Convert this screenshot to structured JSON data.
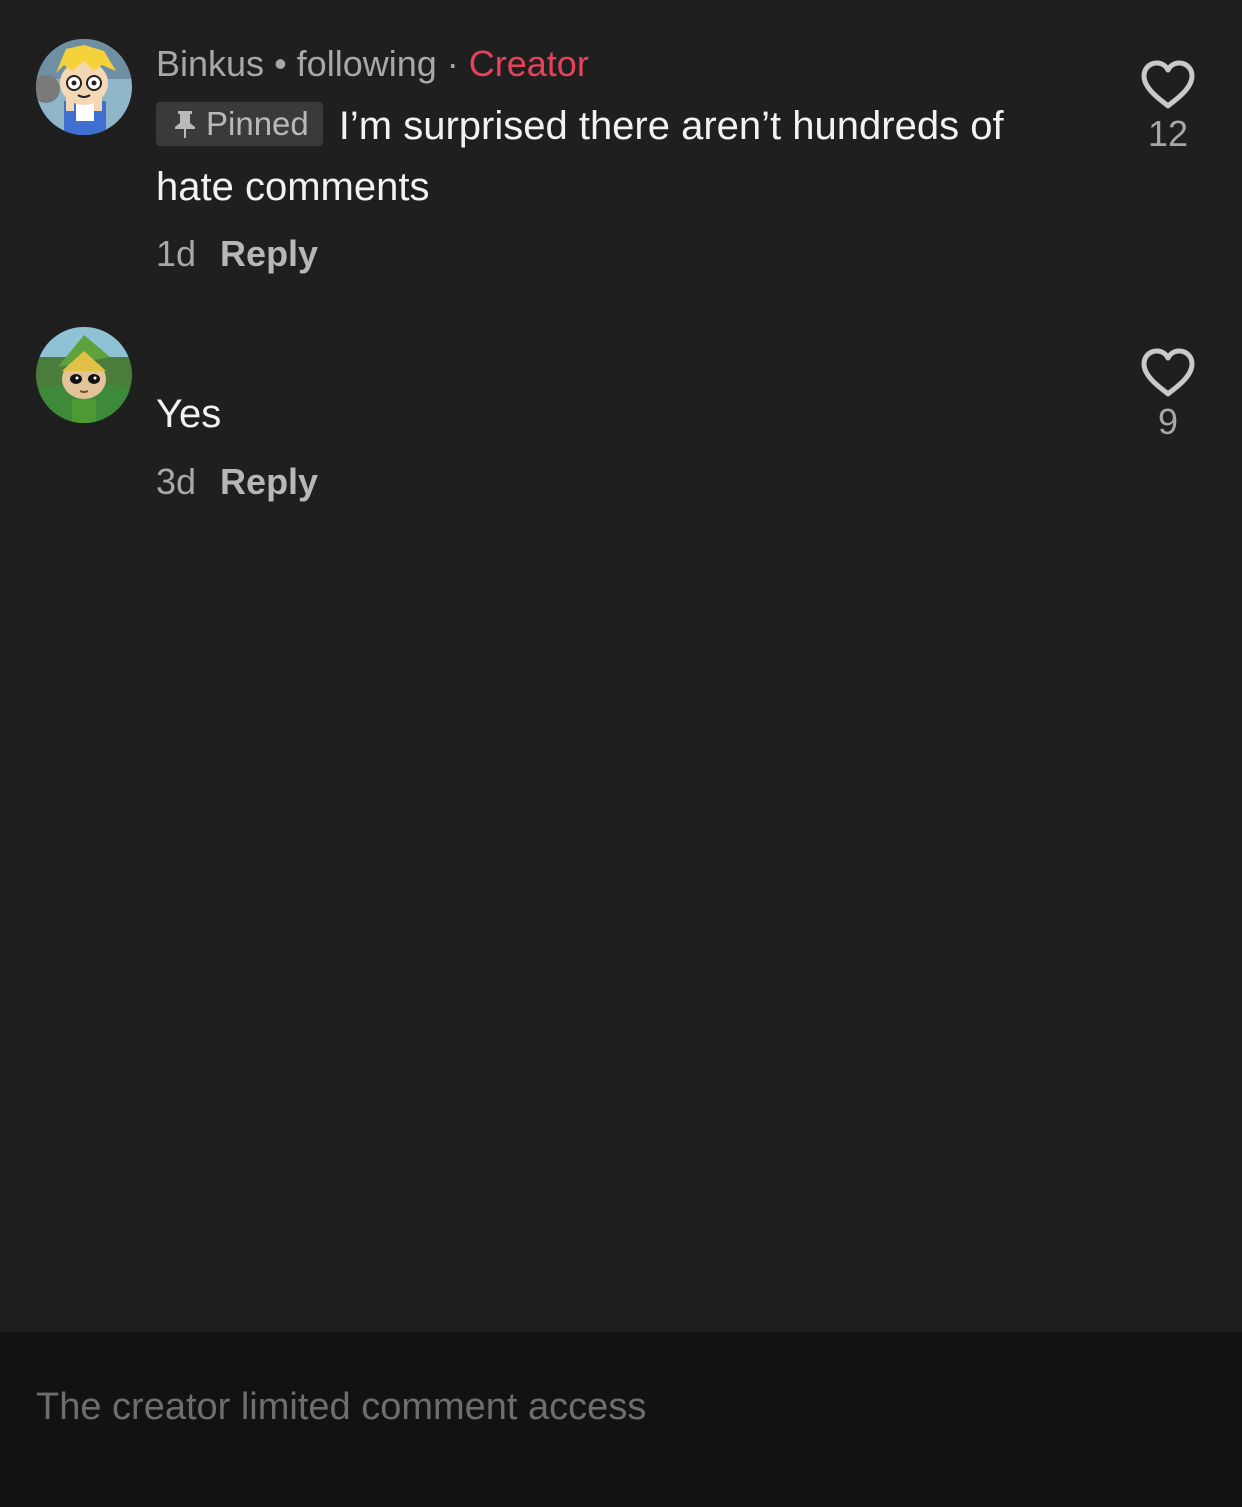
{
  "comments": [
    {
      "username": "Binkus",
      "relation": "following",
      "badge": "Creator",
      "pinned_label": "Pinned",
      "text": "I’m surprised there aren’t hundreds of hate comments",
      "age": "1d",
      "reply_label": "Reply",
      "likes": "12",
      "avatar_icon": "cartoon-blonde-character-avatar"
    },
    {
      "text": "Yes",
      "age": "3d",
      "reply_label": "Reply",
      "likes": "9",
      "avatar_icon": "cartoon-green-elf-avatar"
    }
  ],
  "bottom_bar": {
    "message": "The creator limited comment access"
  },
  "colors": {
    "background": "#1f1f20",
    "creator_accent": "#e5435a",
    "secondary_text": "#a8a8aa",
    "bottom_bar": "#121212"
  }
}
